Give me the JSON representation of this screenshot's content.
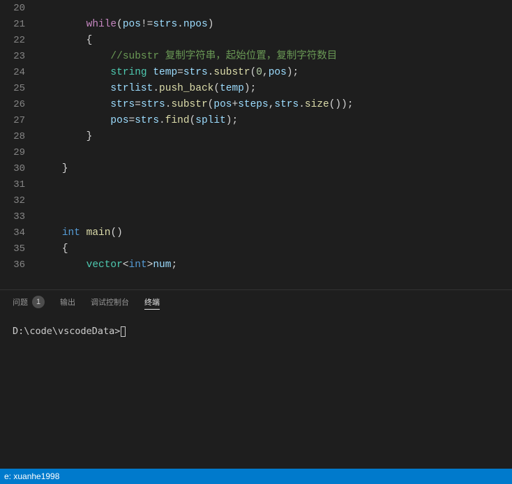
{
  "editor": {
    "line_numbers": [
      "20",
      "21",
      "22",
      "23",
      "24",
      "25",
      "26",
      "27",
      "28",
      "29",
      "30",
      "31",
      "32",
      "33",
      "34",
      "35",
      "36"
    ],
    "lines": [
      {
        "indent": "",
        "tokens": []
      },
      {
        "indent": "        ",
        "tokens": [
          {
            "t": "control",
            "v": "while"
          },
          {
            "t": "punct",
            "v": "("
          },
          {
            "t": "var",
            "v": "pos"
          },
          {
            "t": "op",
            "v": "!="
          },
          {
            "t": "var",
            "v": "strs"
          },
          {
            "t": "punct",
            "v": "."
          },
          {
            "t": "var",
            "v": "npos"
          },
          {
            "t": "punct",
            "v": ")"
          }
        ]
      },
      {
        "indent": "        ",
        "tokens": [
          {
            "t": "punct",
            "v": "{"
          }
        ]
      },
      {
        "indent": "            ",
        "tokens": [
          {
            "t": "comment",
            "v": "//substr 复制字符串，起始位置，复制字符数目"
          }
        ]
      },
      {
        "indent": "            ",
        "tokens": [
          {
            "t": "type",
            "v": "string"
          },
          {
            "t": "punct",
            "v": " "
          },
          {
            "t": "var",
            "v": "temp"
          },
          {
            "t": "op",
            "v": "="
          },
          {
            "t": "var",
            "v": "strs"
          },
          {
            "t": "punct",
            "v": "."
          },
          {
            "t": "func",
            "v": "substr"
          },
          {
            "t": "punct",
            "v": "("
          },
          {
            "t": "num",
            "v": "0"
          },
          {
            "t": "punct",
            "v": ","
          },
          {
            "t": "var",
            "v": "pos"
          },
          {
            "t": "punct",
            "v": ");"
          }
        ]
      },
      {
        "indent": "            ",
        "tokens": [
          {
            "t": "var",
            "v": "strlist"
          },
          {
            "t": "punct",
            "v": "."
          },
          {
            "t": "func",
            "v": "push_back"
          },
          {
            "t": "punct",
            "v": "("
          },
          {
            "t": "var",
            "v": "temp"
          },
          {
            "t": "punct",
            "v": ");"
          }
        ]
      },
      {
        "indent": "            ",
        "tokens": [
          {
            "t": "var",
            "v": "strs"
          },
          {
            "t": "op",
            "v": "="
          },
          {
            "t": "var",
            "v": "strs"
          },
          {
            "t": "punct",
            "v": "."
          },
          {
            "t": "func",
            "v": "substr"
          },
          {
            "t": "punct",
            "v": "("
          },
          {
            "t": "var",
            "v": "pos"
          },
          {
            "t": "op",
            "v": "+"
          },
          {
            "t": "var",
            "v": "steps"
          },
          {
            "t": "punct",
            "v": ","
          },
          {
            "t": "var",
            "v": "strs"
          },
          {
            "t": "punct",
            "v": "."
          },
          {
            "t": "func",
            "v": "size"
          },
          {
            "t": "punct",
            "v": "());"
          }
        ]
      },
      {
        "indent": "            ",
        "tokens": [
          {
            "t": "var",
            "v": "pos"
          },
          {
            "t": "op",
            "v": "="
          },
          {
            "t": "var",
            "v": "strs"
          },
          {
            "t": "punct",
            "v": "."
          },
          {
            "t": "func",
            "v": "find"
          },
          {
            "t": "punct",
            "v": "("
          },
          {
            "t": "var",
            "v": "split"
          },
          {
            "t": "punct",
            "v": ");"
          }
        ]
      },
      {
        "indent": "        ",
        "tokens": [
          {
            "t": "punct",
            "v": "}"
          }
        ]
      },
      {
        "indent": "",
        "tokens": []
      },
      {
        "indent": "    ",
        "tokens": [
          {
            "t": "punct",
            "v": "}"
          }
        ]
      },
      {
        "indent": "",
        "tokens": []
      },
      {
        "indent": "",
        "tokens": []
      },
      {
        "indent": "",
        "tokens": []
      },
      {
        "indent": "    ",
        "tokens": [
          {
            "t": "keyword",
            "v": "int"
          },
          {
            "t": "punct",
            "v": " "
          },
          {
            "t": "func",
            "v": "main"
          },
          {
            "t": "punct",
            "v": "()"
          }
        ]
      },
      {
        "indent": "    ",
        "tokens": [
          {
            "t": "punct",
            "v": "{"
          }
        ]
      },
      {
        "indent": "        ",
        "tokens": [
          {
            "t": "type",
            "v": "vector"
          },
          {
            "t": "punct",
            "v": "<"
          },
          {
            "t": "keyword",
            "v": "int"
          },
          {
            "t": "punct",
            "v": ">"
          },
          {
            "t": "var",
            "v": "num"
          },
          {
            "t": "punct",
            "v": ";"
          }
        ]
      }
    ]
  },
  "panel": {
    "tabs": {
      "problems": "问题",
      "problems_badge": "1",
      "output": "输出",
      "debug_console": "调试控制台",
      "terminal": "终端"
    },
    "terminal_prompt": "D:\\code\\vscodeData>"
  },
  "statusbar": {
    "left": "e: xuanhe1998"
  }
}
